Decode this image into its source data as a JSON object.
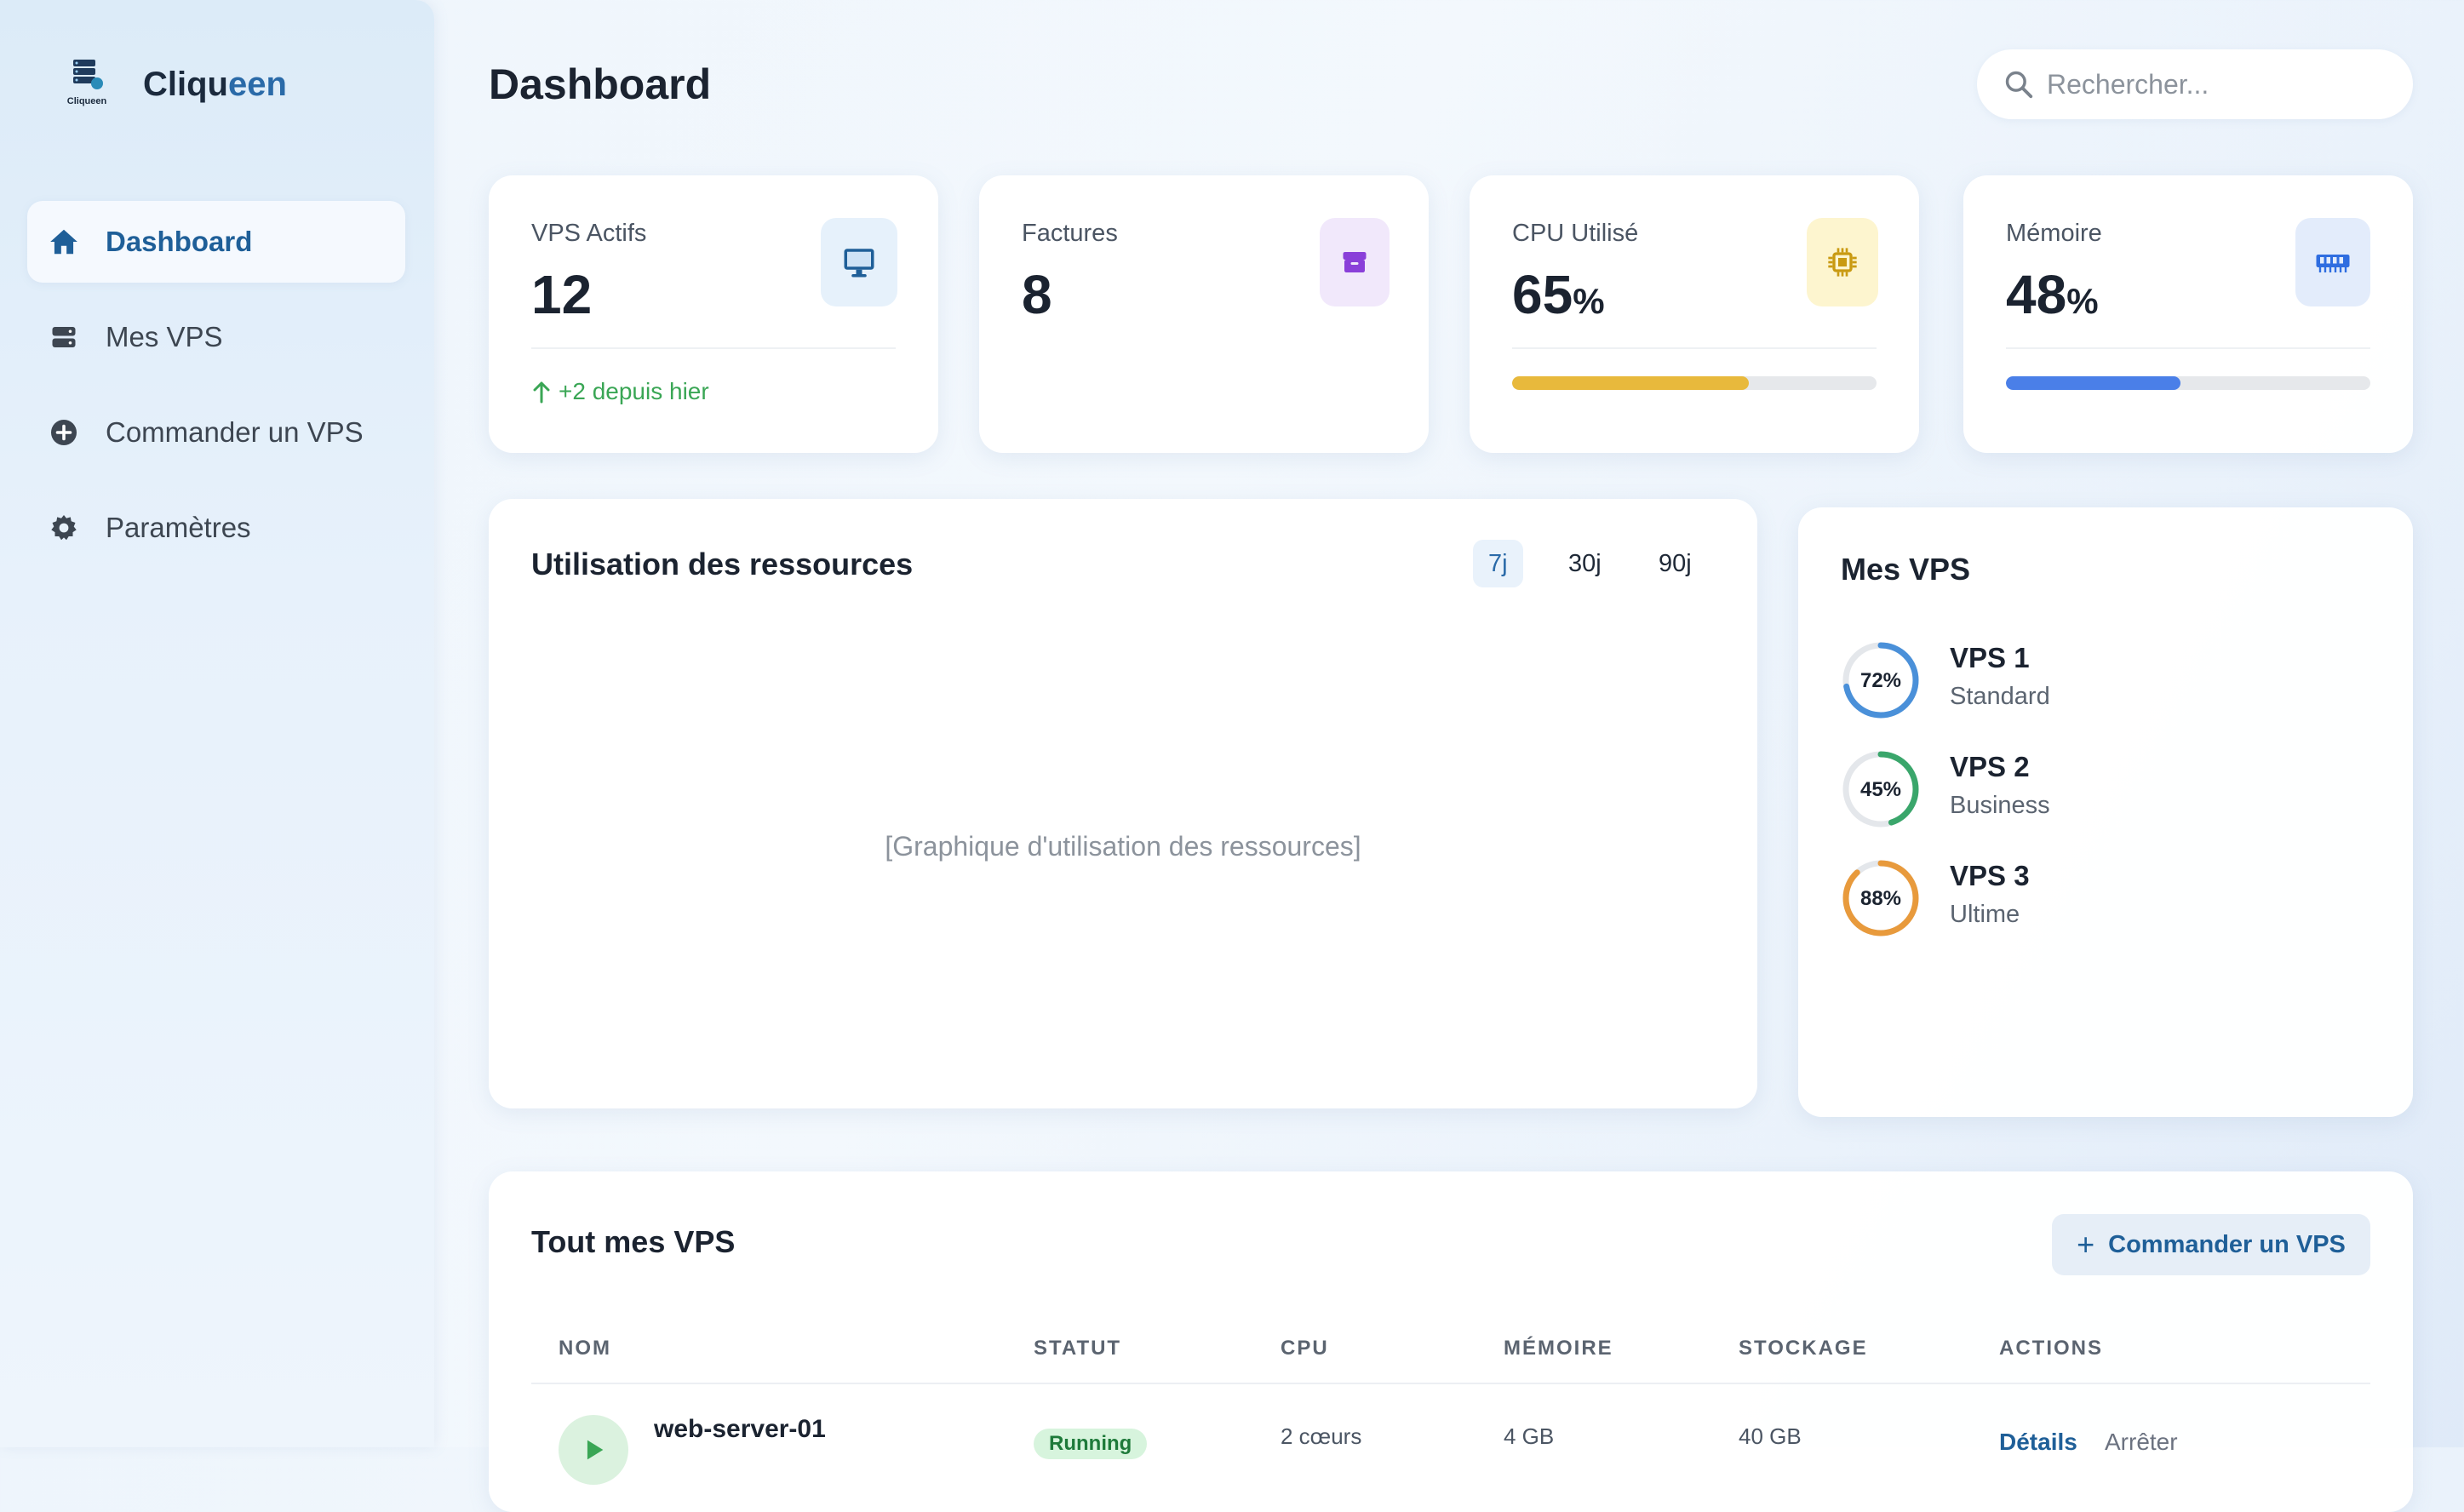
{
  "app": {
    "logo_caption": "Cliqueen",
    "name_part1": "Cliqu",
    "name_part2": "een"
  },
  "sidebar": {
    "items": [
      {
        "label": "Dashboard",
        "icon": "home-icon",
        "active": true
      },
      {
        "label": "Mes VPS",
        "icon": "server-icon",
        "active": false
      },
      {
        "label": "Commander un VPS",
        "icon": "plus-circle-icon",
        "active": false
      },
      {
        "label": "Paramètres",
        "icon": "gear-icon",
        "active": false
      }
    ]
  },
  "header": {
    "title": "Dashboard",
    "search_placeholder": "Rechercher..."
  },
  "stats": [
    {
      "label": "VPS Actifs",
      "value": "12",
      "unit": "",
      "icon": "monitor-icon",
      "icon_color": "#1f5f98",
      "icon_bg": "#e6f1fb",
      "trend": "+2 depuis hier",
      "trend_color": "#3aa655"
    },
    {
      "label": "Factures",
      "value": "8",
      "unit": "",
      "icon": "box-icon",
      "icon_color": "#8a3fd9",
      "icon_bg": "#f1e8fb"
    },
    {
      "label": "CPU Utilisé",
      "value": "65",
      "unit": "%",
      "icon": "chip-icon",
      "icon_color": "#c99a12",
      "icon_bg": "#fdf5cf",
      "progress": 0.65,
      "bar_color": "#e8b93c"
    },
    {
      "label": "Mémoire",
      "value": "48",
      "unit": "%",
      "icon": "memory-icon",
      "icon_color": "#2f6de0",
      "icon_bg": "#e3ecfb",
      "progress": 0.48,
      "bar_color": "#4a7fe8"
    }
  ],
  "resources": {
    "title": "Utilisation des ressources",
    "ranges": [
      "7j",
      "30j",
      "90j"
    ],
    "active_range": "7j",
    "placeholder": "[Graphique d'utilisation des ressources]"
  },
  "my_vps": {
    "title": "Mes VPS",
    "items": [
      {
        "name": "VPS 1",
        "plan": "Standard",
        "usage_label": "72%",
        "usage": 0.72,
        "color": "#4a90d9"
      },
      {
        "name": "VPS 2",
        "plan": "Business",
        "usage_label": "45%",
        "usage": 0.45,
        "color": "#3aa66b"
      },
      {
        "name": "VPS 3",
        "plan": "Ultime",
        "usage_label": "88%",
        "usage": 0.88,
        "color": "#e89a3c"
      }
    ]
  },
  "table": {
    "title": "Tout mes VPS",
    "order_button": "Commander un VPS",
    "columns": [
      "NOM",
      "STATUT",
      "CPU",
      "MÉMOIRE",
      "STOCKAGE",
      "ACTIONS"
    ],
    "rows": [
      {
        "name": "web-server-01",
        "status": "Running",
        "cpu": "2 cœurs",
        "memory": "4 GB",
        "storage": "40 GB",
        "action_details": "Détails",
        "action_stop": "Arrêter"
      }
    ]
  },
  "colors": {
    "accent": "#1f5f98",
    "success": "#3aa655"
  }
}
